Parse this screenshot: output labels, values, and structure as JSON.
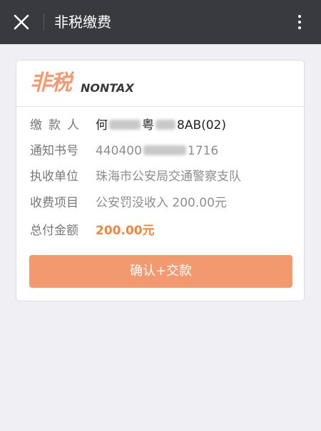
{
  "topbar": {
    "title": "非税缴费",
    "background": "#393a3f"
  },
  "logo": {
    "cn": "非税",
    "en": "NONTAX",
    "accent": "#f49a72"
  },
  "details": {
    "payer": {
      "label": "缴款人",
      "value_prefix": "何",
      "value_mid": "粤",
      "value_suffix": "8AB(02)"
    },
    "notice_no": {
      "label": "通知书号",
      "value_prefix": "440400",
      "value_suffix": "1716"
    },
    "agency": {
      "label": "执收单位",
      "value": "珠海市公安局交通警察支队"
    },
    "item": {
      "label": "收费项目",
      "value": "公安罚没收入",
      "amount": "200.00元"
    },
    "total": {
      "label": "总付金额",
      "value": "200.00元",
      "color": "#f0863c"
    }
  },
  "confirm_button": {
    "label": "确认+交款",
    "color": "#f3996f"
  },
  "icons": {
    "close": "close-icon",
    "more": "more-vertical-icon"
  }
}
